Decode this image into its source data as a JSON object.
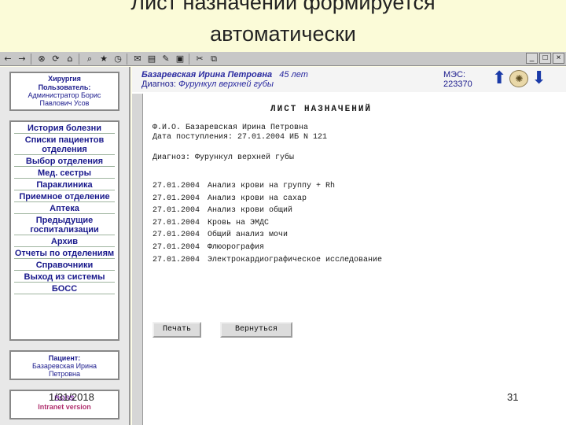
{
  "slide": {
    "title_line1": "Лист назначений формируется",
    "title_line2": "автоматически",
    "date": "1/31/2018",
    "page_number": "31"
  },
  "toolbar": {
    "icons": [
      "back-icon",
      "forward-icon",
      "stop-icon",
      "refresh-icon",
      "home-icon",
      "search-icon",
      "favorites-icon",
      "history-icon",
      "mail-icon",
      "print-icon",
      "edit-icon",
      "discuss-icon",
      "cut-icon",
      "copy-icon"
    ],
    "window_controls": [
      "_",
      "□",
      "×"
    ]
  },
  "sidebar": {
    "department": "Хирургия",
    "user_label": "Пользователь:",
    "user_name_line1": "Администратор Борис",
    "user_name_line2": "Павлович Усов",
    "menu_items": [
      "История болезни",
      "Списки пациентов отделения",
      "Выбор отделения",
      "Мед. сестры",
      "Параклиника",
      "Приемное отделение",
      "Аптека",
      "Предыдущие госпитализации",
      "Архив",
      "Отчеты по отделениям",
      "Справочники",
      "Выход из системы",
      "БОСС"
    ],
    "patient_label": "Пациент:",
    "patient_line1": "Базаревская Ирина",
    "patient_line2": "Петровна",
    "logo_text": "BOSS",
    "logo_sub": "Intranet version"
  },
  "header": {
    "patient_name": "Базаревская Ирина Петровна",
    "patient_age": "45 лет",
    "diagnosis_label": "Диагноз:",
    "diagnosis": "Фурункул верхней губы",
    "mes_label": "МЭС:",
    "mes_code": "223370"
  },
  "sheet": {
    "title": "ЛИСТ НАЗНАЧЕНИЙ",
    "fio_line": "Ф.И.О. Базаревская Ирина Петровна",
    "admission_line": "Дата поступления: 27.01.2004   ИБ N 121",
    "diagnosis_line": "Диагноз: Фурункул верхней губы",
    "orders": [
      {
        "date": "27.01.2004",
        "text": "Анализ крови на группу + Rh"
      },
      {
        "date": "27.01.2004",
        "text": "Анализ крови на сахар"
      },
      {
        "date": "27.01.2004",
        "text": "Анализ крови общий"
      },
      {
        "date": "27.01.2004",
        "text": "Кровь на ЭМДС"
      },
      {
        "date": "27.01.2004",
        "text": "Общий анализ мочи"
      },
      {
        "date": "27.01.2004",
        "text": "Флюорография"
      },
      {
        "date": "27.01.2004",
        "text": "Электрокардиографическое исследование"
      }
    ],
    "print_button": "Печать",
    "back_button": "Вернуться"
  }
}
